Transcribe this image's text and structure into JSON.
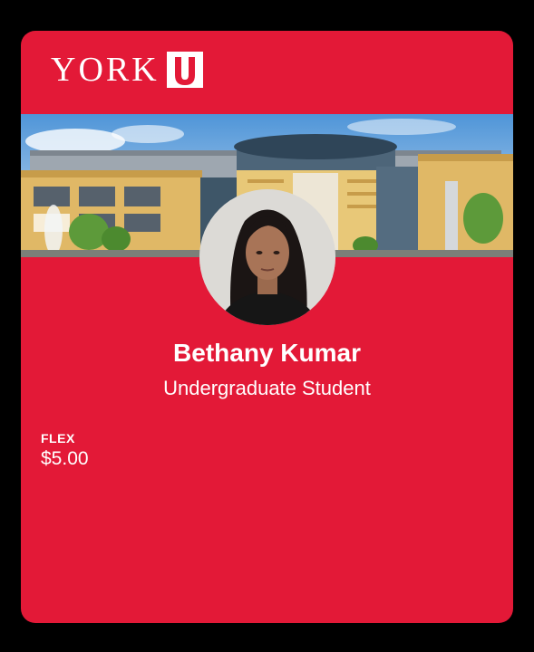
{
  "card": {
    "logo_text": "YORK",
    "logo_mark": "U",
    "banner_image": "campus-building-photo",
    "avatar_image": "student-portrait-photo",
    "name": "Bethany Kumar",
    "role": "Undergraduate Student",
    "balance_label": "FLEX",
    "balance_value": "$5.00"
  },
  "colors": {
    "page_background": "#000000",
    "card_red": "#e31937",
    "text": "#ffffff"
  }
}
